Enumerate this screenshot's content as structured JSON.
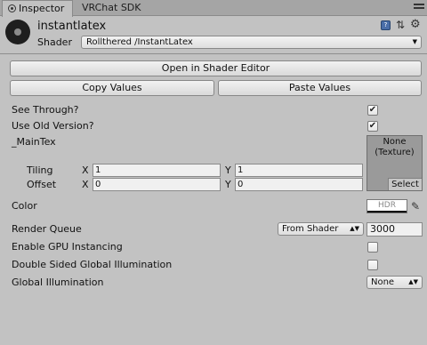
{
  "tabs": [
    {
      "label": "Inspector",
      "active": true
    },
    {
      "label": "VRChat SDK",
      "active": false
    }
  ],
  "header": {
    "material_name": "instantlatex",
    "shader_label": "Shader",
    "shader_value": "Rollthered /InstantLatex"
  },
  "buttons": {
    "open_editor": "Open in Shader Editor",
    "copy": "Copy Values",
    "paste": "Paste Values"
  },
  "properties": {
    "see_through": {
      "label": "See Through?",
      "checked": true,
      "mark": "✔"
    },
    "use_old_version": {
      "label": "Use Old Version?",
      "checked": true,
      "mark": "✔"
    },
    "main_tex": {
      "label": "_MainTex",
      "texture_none": "None",
      "texture_type": "(Texture)",
      "select_label": "Select",
      "tiling_label": "Tiling",
      "offset_label": "Offset",
      "x_label": "X",
      "y_label": "Y",
      "tiling_x": "1",
      "tiling_y": "1",
      "offset_x": "0",
      "offset_y": "0"
    },
    "color": {
      "label": "Color",
      "swatch_text": "HDR",
      "value": "#ffffff"
    }
  },
  "render": {
    "render_queue_label": "Render Queue",
    "render_queue_mode": "From Shader",
    "render_queue_value": "3000",
    "gpu_instancing_label": "Enable GPU Instancing",
    "gpu_instancing_checked": false,
    "double_sided_gi_label": "Double Sided Global Illumination",
    "double_sided_gi_checked": false,
    "global_illumination_label": "Global Illumination",
    "global_illumination_value": "None"
  },
  "icons": {
    "book": "book-icon",
    "settings": "settings-icon",
    "gear": "gear-icon",
    "eyedropper": "eyedropper-icon"
  }
}
